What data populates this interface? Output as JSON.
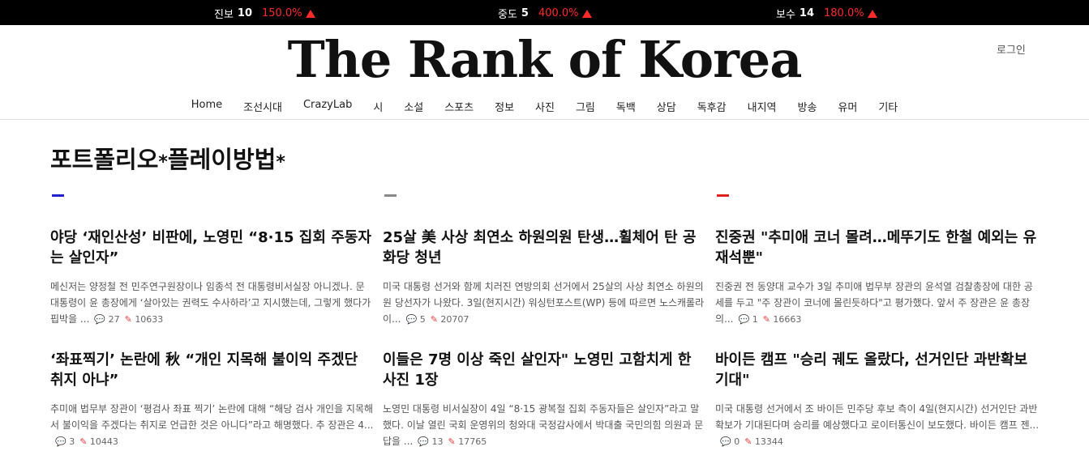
{
  "ticker": [
    {
      "label": "진보",
      "count": "10",
      "percent": "150.0%"
    },
    {
      "label": "중도",
      "count": "5",
      "percent": "400.0%"
    },
    {
      "label": "보수",
      "count": "14",
      "percent": "180.0%"
    }
  ],
  "site": {
    "logo": "The Rank of Korea",
    "login": "로그인"
  },
  "nav": [
    "Home",
    "조선시대",
    "CrazyLab",
    "시",
    "소설",
    "스포츠",
    "정보",
    "사진",
    "그림",
    "독백",
    "상담",
    "독후감",
    "내지역",
    "방송",
    "유머",
    "기타"
  ],
  "page": {
    "title": "포트폴리오",
    "star1": "*",
    "title2": "플레이방법",
    "star2": "*"
  },
  "columns": [
    {
      "accent": "#2222cc",
      "articles": [
        {
          "title": "야당 ‘재인산성’ 비판에, 노영민 “8·15 집회 주동자는 살인자”",
          "excerpt": "메신저는 양정철 전 민주연구원장이나 임종석 전 대통령비서실장 아니겠나. 문 대통령이 윤 총장에게 ‘살아있는 권력도 수사하라’고 지시했는데, 그렇게 했다가 핍박을 ...",
          "comments": "27",
          "views": "10633"
        },
        {
          "title": "‘좌표찍기’ 논란에 秋 “개인 지목해 불이익 주겠단 취지 아냐”",
          "excerpt": "추미애 법무부 장관이 ‘평검사 좌표 찍기’ 논란에 대해 “해당 검사 개인을 지목해서 불이익을 주겠다는 취지로 언급한 것은 아니다”라고 해명했다. 추 장관은 4...",
          "comments": "3",
          "views": "10443"
        }
      ]
    },
    {
      "accent": "#888888",
      "articles": [
        {
          "title": "25살 美 사상 최연소 하원의원 탄생…휠체어 탄 공화당 청년",
          "excerpt": "미국 대통령 선거와 함께 치러진 연방의회 선거에서 25살의 사상 최연소 하원의원 당선자가 나왔다. 3일(현지시간) 워싱턴포스트(WP) 등에 따르면 노스캐롤라이...",
          "comments": "5",
          "views": "20707"
        },
        {
          "title": "이들은 7명 이상 죽인 살인자\" 노영민 고함치게 한 사진 1장",
          "excerpt": "노영민 대통령 비서실장이 4일 “8·15 광복절 집회 주동자들은 살인자”라고 말했다. 이날 열린 국회 운영위의 청와대 국정감사에서 박대출 국민의힘 의원과 문답을 ...",
          "comments": "13",
          "views": "17765"
        }
      ]
    },
    {
      "accent": "#e0201d",
      "articles": [
        {
          "title": "진중권 \"추미애 코너 몰려…메뚜기도 한철 예외는 유재석뿐\"",
          "excerpt": "진중권 전 동양대 교수가 3일 추미애 법무부 장관의 윤석열 검찰총장에 대한 공세를 두고 \"주 장관이 코너에 몰린듯하다\"고 평가했다. 앞서 주 장관은 윤 총장의...",
          "comments": "1",
          "views": "16663"
        },
        {
          "title": "바이든 캠프 \"승리 궤도 올랐다, 선거인단 과반확보 기대\"",
          "excerpt": "미국 대통령 선거에서 조 바이든 민주당 후보 측이 4일(현지시간) 선거인단 과반 확보가 기대된다며 승리를 예상했다고 로이터통신이 보도했다. 바이든 캠프 젠...",
          "comments": "0",
          "views": "13344"
        }
      ]
    }
  ]
}
